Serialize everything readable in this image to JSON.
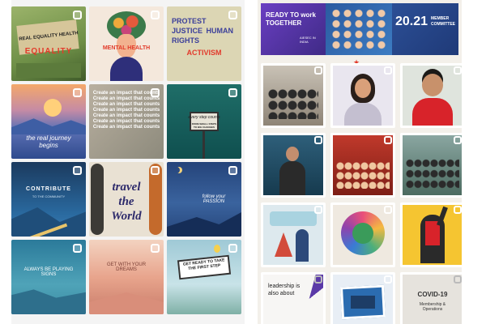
{
  "left_feed": {
    "posts": [
      {
        "title": "EQUALITY",
        "caption": "REAL EQUALITY HEALTH"
      },
      {
        "title": "MENTAL HEALTH"
      },
      {
        "title": "ACTIVISM",
        "caption": "PROTEST JUSTICE HUMAN RIGHTS"
      },
      {
        "title": "the real journey begins"
      },
      {
        "title": "Create an impact that counts"
      },
      {
        "title": "every step counts",
        "caption": "FROM SMALL STEPS TO BIG CHANGES"
      },
      {
        "title": "CONTRIBUTE",
        "caption": "TO THE COMMUNITY"
      },
      {
        "title": "travel the World"
      },
      {
        "title": "follow your PASSION"
      },
      {
        "title": "ALWAYS BE PLAYING SIGNS"
      },
      {
        "title": "GET WITH YOUR DREAMS"
      },
      {
        "title": "GET READY TO TAKE THE FIRST STEP"
      }
    ]
  },
  "right_feed": {
    "header": {
      "title": "READY TO work TOGETHER",
      "subtitle": "AIESEC IN INDIA",
      "year": "20.21",
      "member": "MEMBER",
      "committee": "COMMITTEE"
    },
    "posts": [
      {
        "label": "group photo"
      },
      {
        "label": "woman portrait"
      },
      {
        "label": "man portrait"
      },
      {
        "label": "event speaker"
      },
      {
        "label": "team stage"
      },
      {
        "label": "group outdoor"
      },
      {
        "label": "cups illustration"
      },
      {
        "label": "earth hands"
      },
      {
        "label": "raise hand illustration"
      },
      {
        "caption": "leadership is also about"
      },
      {
        "label": "bus photo"
      },
      {
        "title": "COVID-19",
        "caption": "Membership & Operations"
      }
    ]
  },
  "colors": {
    "bg_left": "#f4f4f4",
    "bg_right": "#f3f0ea",
    "accent_purple": "#5b3aa8"
  }
}
